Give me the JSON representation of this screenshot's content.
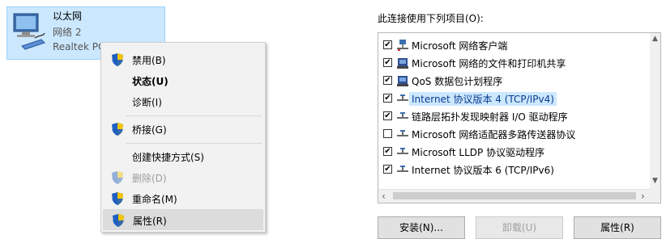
{
  "adapter": {
    "name": "以太网",
    "network": "网络  2",
    "device": "Realtek PCIe GbE Family Controller"
  },
  "context_menu": {
    "items": [
      {
        "label": "禁用(B)",
        "icon": "shield-icon"
      },
      {
        "label": "状态(U)",
        "bold": true
      },
      {
        "label": "诊断(I)"
      },
      {
        "label": "桥接(G)",
        "icon": "shield-icon"
      },
      {
        "label": "创建快捷方式(S)"
      },
      {
        "label": "删除(D)",
        "icon": "shield-icon",
        "disabled": true
      },
      {
        "label": "重命名(M)",
        "icon": "shield-icon"
      },
      {
        "label": "属性(R)",
        "icon": "shield-icon",
        "highlighted": true
      }
    ]
  },
  "properties": {
    "caption": "此连接使用下列项目(O):",
    "items": [
      {
        "label": "Microsoft 网络客户端",
        "checked": true,
        "icon": "network-client-icon"
      },
      {
        "label": "Microsoft 网络的文件和打印机共享",
        "checked": true,
        "icon": "file-printer-share-icon"
      },
      {
        "label": "QoS 数据包计划程序",
        "checked": true,
        "icon": "qos-scheduler-icon"
      },
      {
        "label": "Internet 协议版本 4 (TCP/IPv4)",
        "checked": true,
        "icon": "protocol-icon",
        "selected": true
      },
      {
        "label": "链路层拓扑发现映射器 I/O 驱动程序",
        "checked": true,
        "icon": "protocol-icon"
      },
      {
        "label": "Microsoft 网络适配器多路传送器协议",
        "checked": false,
        "icon": "protocol-icon"
      },
      {
        "label": "Microsoft LLDP 协议驱动程序",
        "checked": true,
        "icon": "protocol-icon"
      },
      {
        "label": "Internet 协议版本 6 (TCP/IPv6)",
        "checked": true,
        "icon": "protocol-icon"
      }
    ],
    "check_glyph": "✔",
    "buttons": {
      "install": "安装(N)...",
      "uninstall": "卸载(U)",
      "properties": "属性(R)"
    }
  },
  "colors": {
    "selection_bg": "#cce8ff",
    "menu_bg": "#f2f2f2",
    "shield_blue": "#1f5fbf",
    "shield_yellow": "#f5c400"
  }
}
